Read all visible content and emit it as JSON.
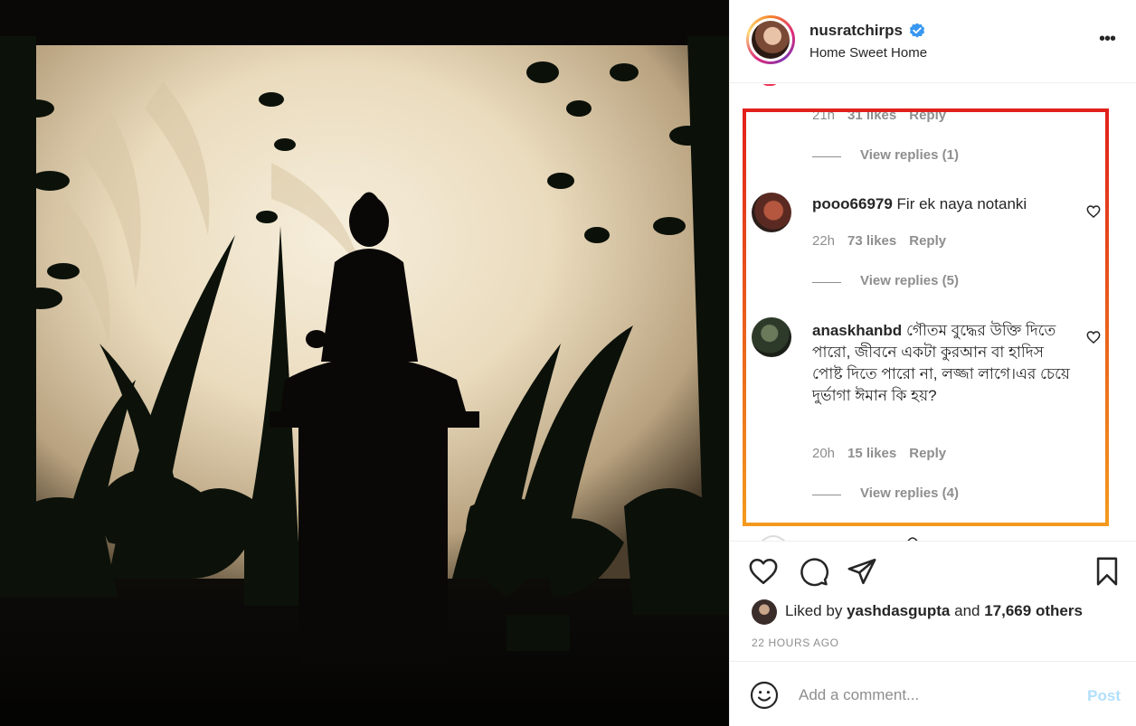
{
  "post": {
    "username": "nusratchirps",
    "location": "Home Sweet Home",
    "verified": true,
    "photo_alt_icon": "buddha-silhouette-image"
  },
  "comments": {
    "partial_top": {
      "time": "21h",
      "likes": "31 likes",
      "reply": "Reply",
      "view_replies": "View replies (1)"
    },
    "items": [
      {
        "username": "pooo66979",
        "text": "Fir ek naya notanki",
        "time": "22h",
        "likes": "73 likes",
        "reply": "Reply",
        "view_replies": "View replies (5)"
      },
      {
        "username": "anaskhanbd",
        "text": "গৌতম বুদ্ধের উক্তি দিতে পারো, জীবনে একটা কুরআন বা হাদিস পোষ্ট দিতে পারো না, লজ্জা লাগে।এর চেয়ে দুর্ভাগা ঈমান কি হয়?",
        "time": "20h",
        "likes": "15 likes",
        "reply": "Reply",
        "view_replies": "View replies (4)"
      }
    ]
  },
  "actions": {
    "liked_by_prefix": "Liked by",
    "liked_by_user": "yashdasgupta",
    "liked_by_and": "and",
    "liked_by_others": "17,669 others",
    "timestamp": "22 HOURS AGO"
  },
  "add_comment": {
    "placeholder": "Add a comment...",
    "post_label": "Post"
  },
  "colors": {
    "link_disabled": "#b2dffc",
    "verified": "#3897f0",
    "highlight_top": "#e1211b",
    "highlight_bottom": "#f39a1e",
    "muted": "#8e8e8e"
  }
}
